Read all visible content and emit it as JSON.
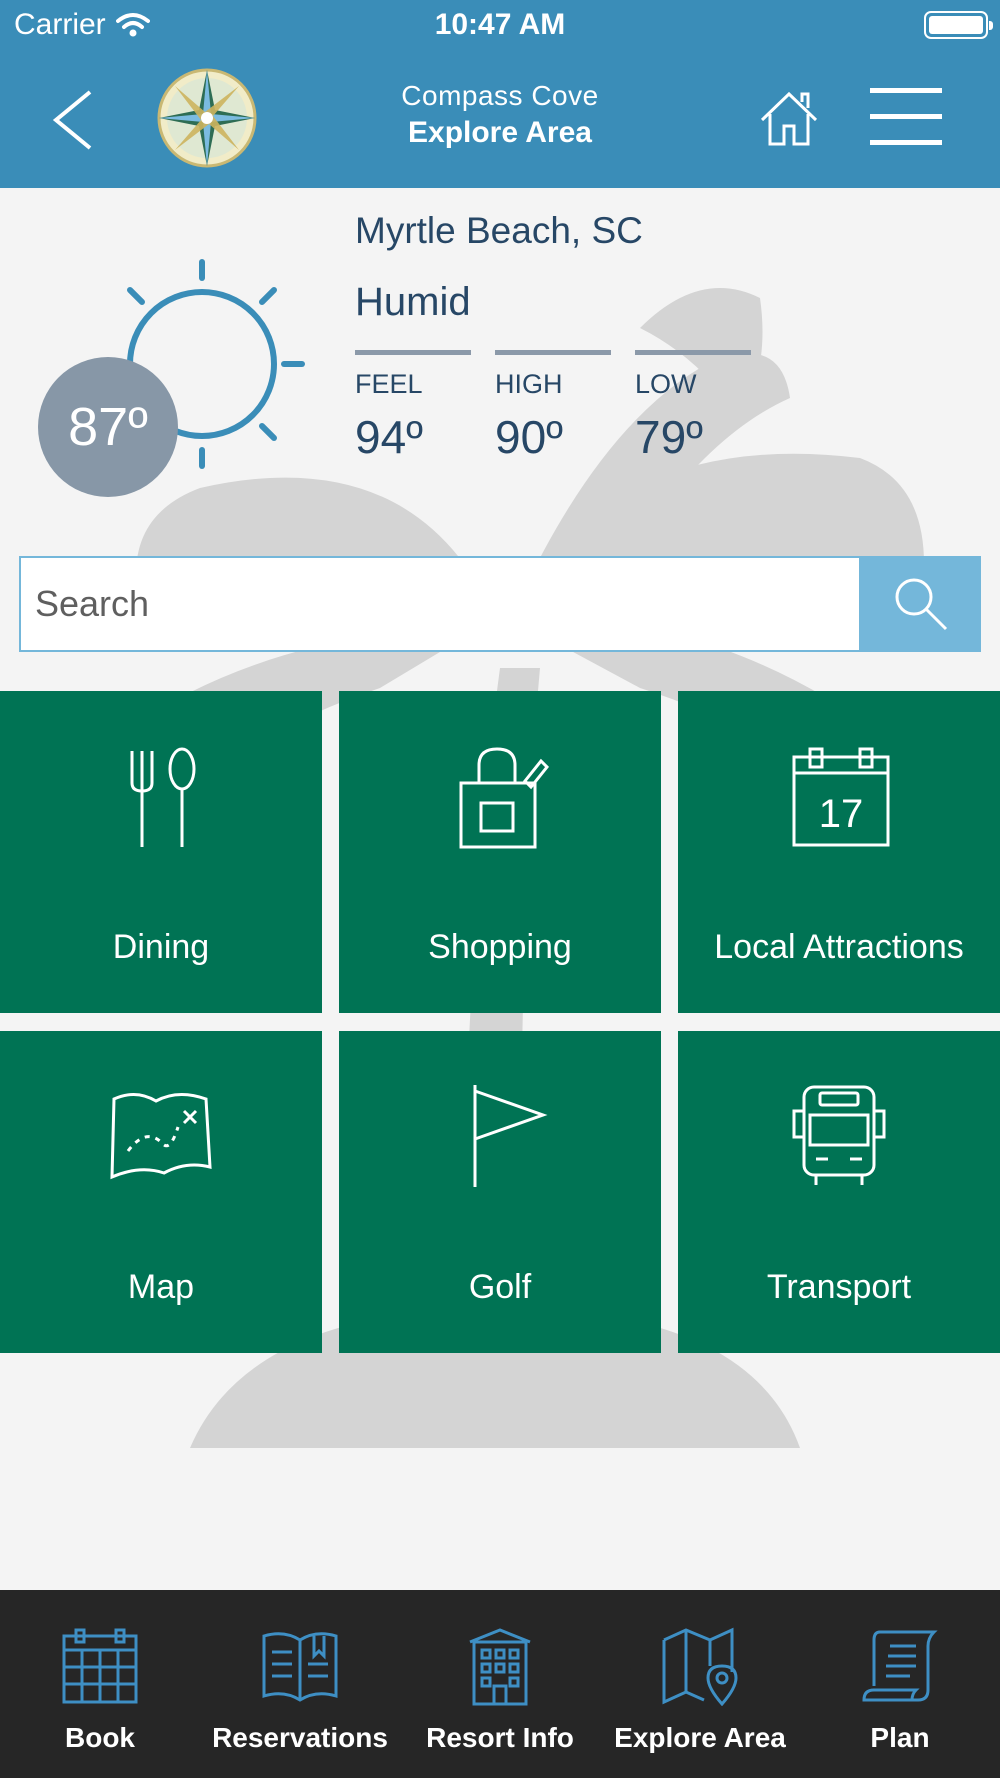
{
  "status_bar": {
    "carrier": "Carrier",
    "time": "10:47 AM"
  },
  "header": {
    "subtitle": "Compass Cove",
    "title": "Explore Area"
  },
  "weather": {
    "temperature": "87º",
    "location": "Myrtle Beach, SC",
    "condition": "Humid",
    "stats": [
      {
        "label": "FEEL",
        "value": "94º"
      },
      {
        "label": "HIGH",
        "value": "90º"
      },
      {
        "label": "LOW",
        "value": "79º"
      }
    ]
  },
  "search": {
    "placeholder": "Search",
    "value": ""
  },
  "tiles": [
    {
      "label": "Dining",
      "icon": "fork-spoon-icon"
    },
    {
      "label": "Shopping",
      "icon": "shopping-bag-icon"
    },
    {
      "label": "Local Attractions",
      "icon": "calendar-icon",
      "calendar_day": "17"
    },
    {
      "label": "Map",
      "icon": "treasure-map-icon"
    },
    {
      "label": "Golf",
      "icon": "golf-flag-icon"
    },
    {
      "label": "Transport",
      "icon": "bus-icon"
    }
  ],
  "bottom_nav": [
    {
      "label": "Book",
      "icon": "calendar-grid-icon"
    },
    {
      "label": "Reservations",
      "icon": "open-book-icon"
    },
    {
      "label": "Resort Info",
      "icon": "building-icon"
    },
    {
      "label": "Explore Area",
      "icon": "map-pin-icon"
    },
    {
      "label": "Plan",
      "icon": "scroll-icon"
    }
  ],
  "colors": {
    "header_bg": "#3a8db8",
    "tile_bg": "#007354",
    "text_dark": "#274766",
    "search_btn": "#74b7da",
    "nav_bg": "#262626",
    "nav_icon": "#3e8fc4",
    "temp_circle": "#8797a7"
  }
}
